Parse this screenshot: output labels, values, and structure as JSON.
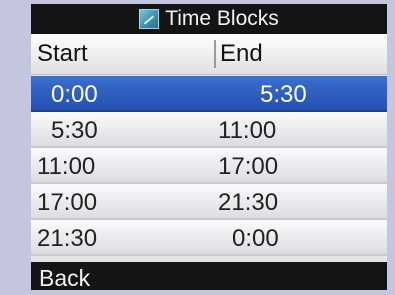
{
  "title": "Time Blocks",
  "title_icon": "schedule-icon",
  "columns": {
    "start": "Start",
    "end": "End"
  },
  "rows": [
    {
      "start": "0:00",
      "end": "5:30",
      "selected": true
    },
    {
      "start": "5:30",
      "end": "11:00",
      "selected": false
    },
    {
      "start": "11:00",
      "end": "17:00",
      "selected": false
    },
    {
      "start": "17:00",
      "end": "21:30",
      "selected": false
    },
    {
      "start": "21:30",
      "end": "0:00",
      "selected": false
    }
  ],
  "footer": {
    "back_label": "Back"
  },
  "colors": {
    "selection": "#2d5cc0",
    "titlebar": "#141414",
    "frame": "#c3c6de"
  }
}
